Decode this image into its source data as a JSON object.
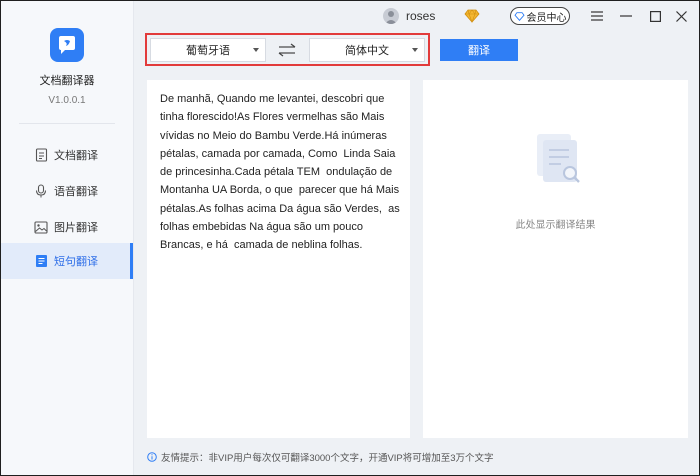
{
  "app": {
    "name": "文档翻译器",
    "version": "V1.0.0.1"
  },
  "sidebar": {
    "items": [
      {
        "label": "文档翻译",
        "icon": "document-icon"
      },
      {
        "label": "语音翻译",
        "icon": "microphone-icon"
      },
      {
        "label": "图片翻译",
        "icon": "image-icon"
      },
      {
        "label": "短句翻译",
        "icon": "text-icon",
        "active": true
      }
    ]
  },
  "topbar": {
    "username": "roses",
    "member_label": "会员中心",
    "controls": [
      "menu-icon",
      "minimize-icon",
      "maximize-icon",
      "close-icon"
    ]
  },
  "translate": {
    "source_lang": "葡萄牙语",
    "target_lang": "简体中文",
    "button_label": "翻译",
    "source_text": "De manhã, Quando me levantei, descobri que\ntinha florescido!As Flores vermelhas são Mais\nvívidas no Meio do Bambu Verde.Há inúmeras\npétalas, camada por camada, Como  Linda Saia\nde princesinha.Cada pétala TEM  ondulação de\nMontanha UA Borda, o que  parecer que há Mais\npétalas.As folhas acima Da água são Verdes,  as\nfolhas embebidas Na água são um pouco\nBrancas, e há  camada de neblina folhas.",
    "result_placeholder": "此处显示翻译结果"
  },
  "footer": {
    "tip": "友情提示：非VIP用户每次仅可翻译3000个文字，开通VIP将可增加至3万个文字"
  },
  "colors": {
    "accent": "#2f7ef5",
    "highlight_border": "#e23b3b"
  }
}
